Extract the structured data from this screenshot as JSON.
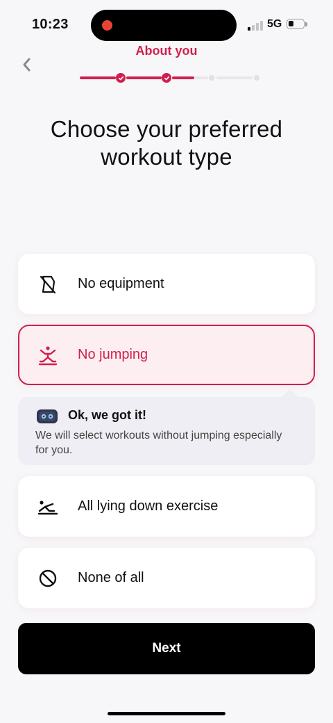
{
  "status_bar": {
    "time": "10:23",
    "network": "5G"
  },
  "header": {
    "section_title": "About you",
    "back_icon": "chevron-left-icon"
  },
  "progress": {
    "completed_steps": 2,
    "total_steps": 4
  },
  "page_title": "Choose your preferred workout type",
  "options": [
    {
      "label": "No equipment",
      "icon": "no-equipment-icon",
      "selected": false
    },
    {
      "label": "No jumping",
      "icon": "no-jumping-icon",
      "selected": true
    },
    {
      "label": "All lying down exercise",
      "icon": "lying-down-icon",
      "selected": false
    },
    {
      "label": "None of all",
      "icon": "prohibited-icon",
      "selected": false
    }
  ],
  "info": {
    "icon": "robot-icon",
    "title": "Ok, we got it!",
    "text": "We will select workouts without jumping especially for you."
  },
  "next_label": "Next",
  "colors": {
    "accent": "#cf1f4d",
    "selected_bg": "#fdeef2",
    "info_bg": "#eeeef4",
    "page_bg": "#f7f6f8",
    "button_bg": "#000000"
  }
}
